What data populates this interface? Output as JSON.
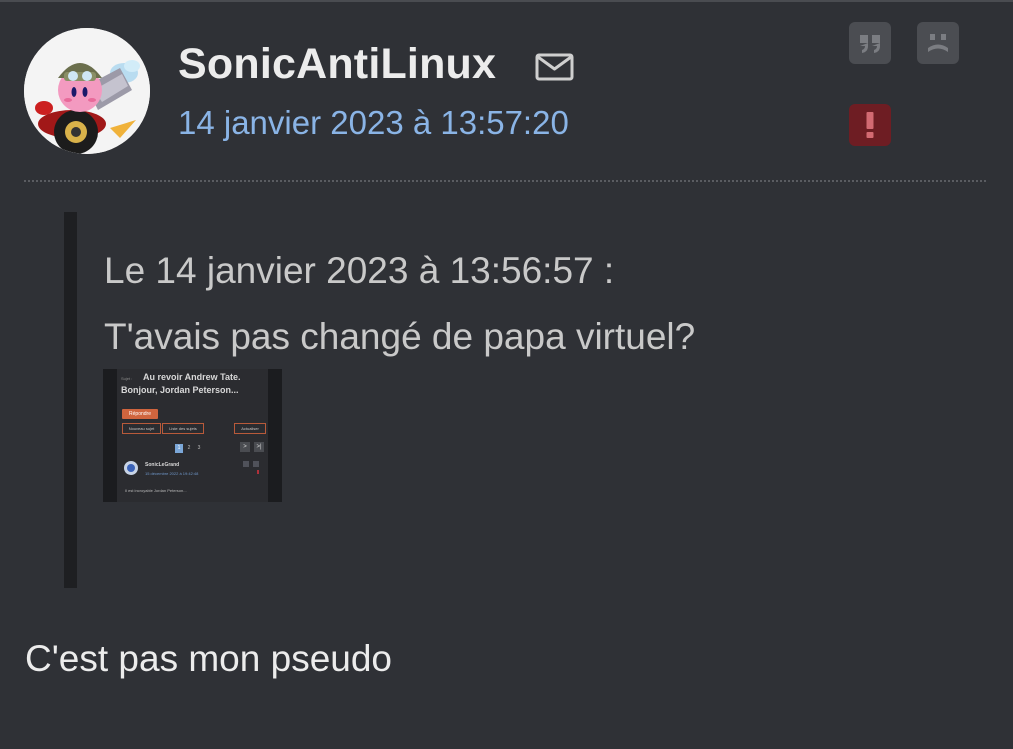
{
  "post": {
    "username": "SonicAntiLinux",
    "date": "14 janvier 2023 à 13:57:20",
    "quote": {
      "header": "Le 14 janvier 2023 à 13:56:57 :",
      "text": "T'avais pas changé de papa virtuel?",
      "thumbnail": {
        "subject_prefix": "Sujet :",
        "subject_line1": "Au revoir Andrew Tate.",
        "subject_line2": "Bonjour, Jordan Peterson...",
        "reply_button": "Répondre",
        "new_topic_button": "Nouveau sujet",
        "topic_list_button": "Liste des sujets",
        "refresh_button": "Actualiser",
        "pages": [
          "1",
          "2",
          "3"
        ],
        "next_arrow": ">",
        "last_arrow": ">|",
        "author": "SonicLeGrand",
        "author_date": "15 décembre 2022 à 19:42:48",
        "message_excerpt": "Il est incroyable Jordan Peterson..."
      }
    },
    "body": "C'est pas mon pseudo"
  },
  "icons": {
    "mail": "envelope-icon",
    "quote": "quote-icon",
    "private_message": "sad-face-icon",
    "alert": "exclamation-icon"
  },
  "colors": {
    "background": "#2f3136",
    "date_link": "#8ab4e6",
    "action_button": "#4b4d52",
    "alert_button": "#6e1d23",
    "quote_bar": "#1e1f22"
  }
}
